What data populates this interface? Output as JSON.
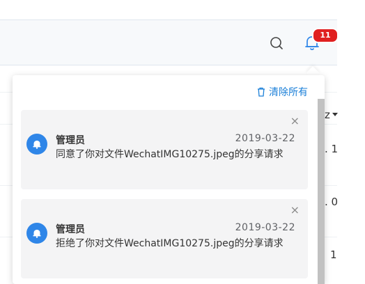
{
  "header": {
    "notification_count": "11"
  },
  "background": {
    "fragments": [
      "z",
      ". 1",
      ". 0",
      "1"
    ]
  },
  "popover": {
    "clear_all_label": "清除所有",
    "close_glyph": "×",
    "notifications": [
      {
        "sender": "管理员",
        "date": "2019-03-22",
        "message": "同意了你对文件WechatIMG10275.jpeg的分享请求"
      },
      {
        "sender": "管理员",
        "date": "2019-03-22",
        "message": "拒绝了你对文件WechatIMG10275.jpeg的分享请求"
      }
    ]
  },
  "colors": {
    "accent": "#1a7fd8",
    "badge": "#e02020",
    "avatar": "#2f86e8",
    "card_bg": "#f4f4f5"
  }
}
